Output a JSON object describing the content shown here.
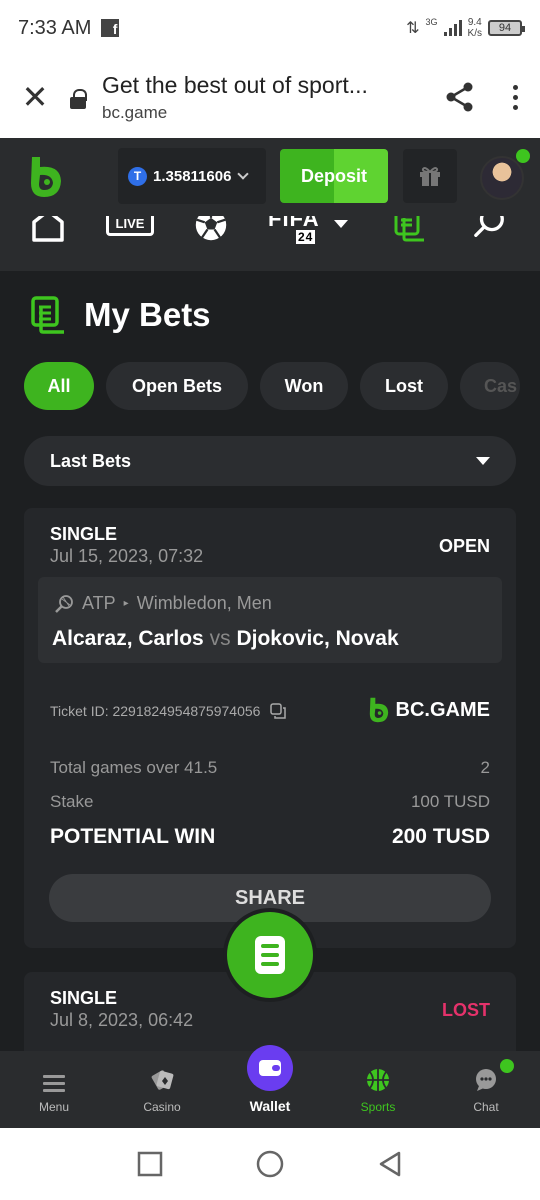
{
  "status_bar": {
    "time": "7:33 AM",
    "network": "3G",
    "speed_top": "9.4",
    "speed_bottom": "K/s",
    "battery": "94"
  },
  "browser": {
    "title": "Get the best out of sport...",
    "domain": "bc.game"
  },
  "header": {
    "balance": "1.35811606",
    "coin_symbol": "T",
    "deposit_label": "Deposit"
  },
  "nav_icons": [
    "home-icon",
    "live-icon",
    "soccer-icon",
    "fifa-icon",
    "bets-icon",
    "search-icon"
  ],
  "nav_live_label": "LIVE",
  "nav_fifa_label": "FIFA",
  "nav_fifa_year": "24",
  "page": {
    "title": "My Bets"
  },
  "filters": [
    "All",
    "Open Bets",
    "Won",
    "Lost",
    "Cas"
  ],
  "select": {
    "value": "Last Bets"
  },
  "bets": [
    {
      "type": "SINGLE",
      "date": "Jul 15, 2023, 07:32",
      "status": "OPEN",
      "sport": "ATP",
      "tournament": "Wimbledon, Men",
      "home": "Alcaraz, Carlos",
      "vs": "vs",
      "away": "Djokovic, Novak",
      "ticket": "Ticket ID: 2291824954875974056",
      "brand": "BC.GAME",
      "market": "Total games over 41.5",
      "odds": "2",
      "stake_label": "Stake",
      "stake": "100 TUSD",
      "win_label": "POTENTIAL WIN",
      "win": "200 TUSD",
      "share_label": "SHARE"
    },
    {
      "type": "SINGLE",
      "date": "Jul 8, 2023, 06:42",
      "status": "LOST"
    }
  ],
  "bottom_nav": [
    {
      "label": "Menu"
    },
    {
      "label": "Casino"
    },
    {
      "label": "Wallet"
    },
    {
      "label": "Sports"
    },
    {
      "label": "Chat"
    }
  ],
  "colors": {
    "accent": "#3eb41f",
    "lost": "#e5326b",
    "wallet": "#6a3df0"
  }
}
